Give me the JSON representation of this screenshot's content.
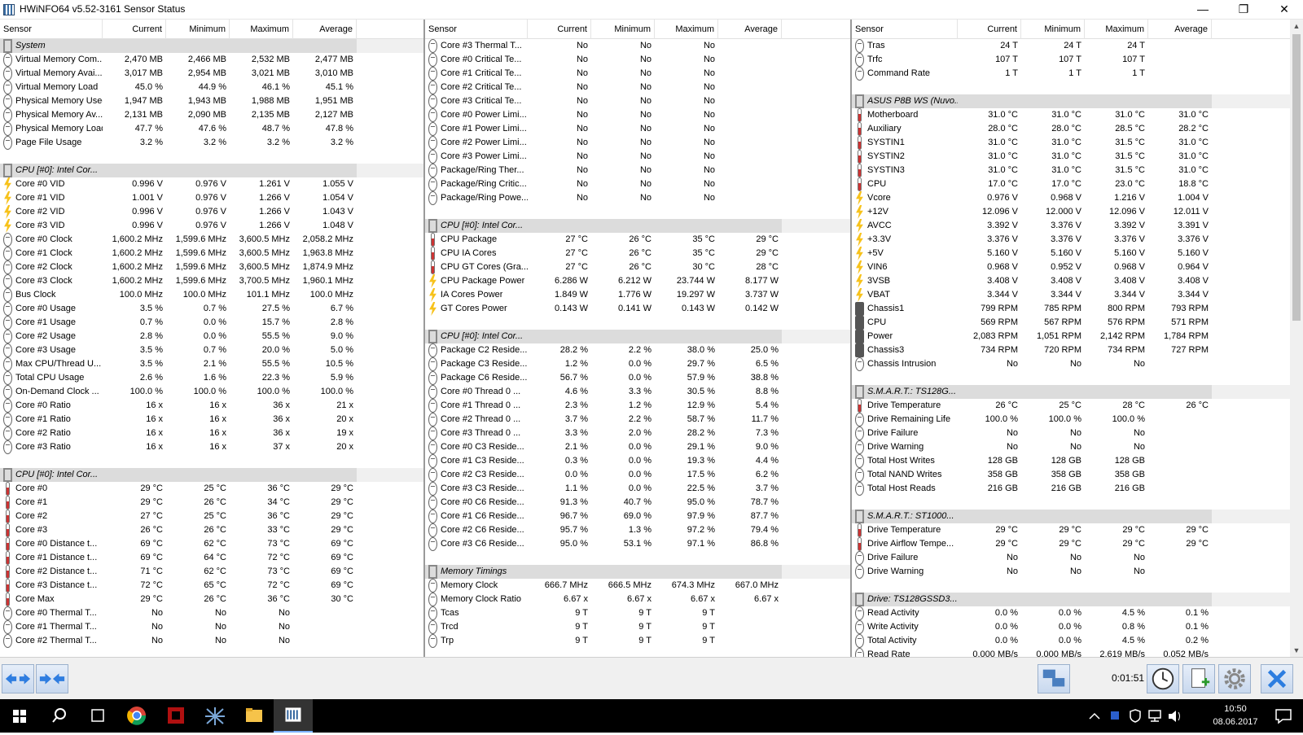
{
  "window": {
    "title": "HWiNFO64 v5.52-3161 Sensor Status",
    "minimize": "—",
    "maximize": "❐",
    "close": "✕"
  },
  "columns": [
    "Sensor",
    "Current",
    "Minimum",
    "Maximum",
    "Average"
  ],
  "panels": [
    {
      "rows": [
        {
          "g": "System"
        },
        [
          "c",
          "Virtual Memory Com...",
          "2,470 MB",
          "2,466 MB",
          "2,532 MB",
          "2,477 MB"
        ],
        [
          "c",
          "Virtual Memory Avai...",
          "3,017 MB",
          "2,954 MB",
          "3,021 MB",
          "3,010 MB"
        ],
        [
          "c",
          "Virtual Memory Load",
          "45.0 %",
          "44.9 %",
          "46.1 %",
          "45.1 %"
        ],
        [
          "c",
          "Physical Memory Used",
          "1,947 MB",
          "1,943 MB",
          "1,988 MB",
          "1,951 MB"
        ],
        [
          "c",
          "Physical Memory Av...",
          "2,131 MB",
          "2,090 MB",
          "2,135 MB",
          "2,127 MB"
        ],
        [
          "c",
          "Physical Memory Load",
          "47.7 %",
          "47.6 %",
          "48.7 %",
          "47.8 %"
        ],
        [
          "c",
          "Page File Usage",
          "3.2 %",
          "3.2 %",
          "3.2 %",
          "3.2 %"
        ],
        {
          "e": 1
        },
        {
          "g": "CPU [#0]: Intel Cor..."
        },
        [
          "v",
          "Core #0 VID",
          "0.996 V",
          "0.976 V",
          "1.261 V",
          "1.055 V"
        ],
        [
          "v",
          "Core #1 VID",
          "1.001 V",
          "0.976 V",
          "1.266 V",
          "1.054 V"
        ],
        [
          "v",
          "Core #2 VID",
          "0.996 V",
          "0.976 V",
          "1.266 V",
          "1.043 V"
        ],
        [
          "v",
          "Core #3 VID",
          "0.996 V",
          "0.976 V",
          "1.266 V",
          "1.048 V"
        ],
        [
          "c",
          "Core #0 Clock",
          "1,600.2 MHz",
          "1,599.6 MHz",
          "3,600.5 MHz",
          "2,058.2 MHz"
        ],
        [
          "c",
          "Core #1 Clock",
          "1,600.2 MHz",
          "1,599.6 MHz",
          "3,600.5 MHz",
          "1,963.8 MHz"
        ],
        [
          "c",
          "Core #2 Clock",
          "1,600.2 MHz",
          "1,599.6 MHz",
          "3,600.5 MHz",
          "1,874.9 MHz"
        ],
        [
          "c",
          "Core #3 Clock",
          "1,600.2 MHz",
          "1,599.6 MHz",
          "3,700.5 MHz",
          "1,960.1 MHz"
        ],
        [
          "c",
          "Bus Clock",
          "100.0 MHz",
          "100.0 MHz",
          "101.1 MHz",
          "100.0 MHz"
        ],
        [
          "c",
          "Core #0 Usage",
          "3.5 %",
          "0.7 %",
          "27.5 %",
          "6.7 %"
        ],
        [
          "c",
          "Core #1 Usage",
          "0.7 %",
          "0.0 %",
          "15.7 %",
          "2.8 %"
        ],
        [
          "c",
          "Core #2 Usage",
          "2.8 %",
          "0.0 %",
          "55.5 %",
          "9.0 %"
        ],
        [
          "c",
          "Core #3 Usage",
          "3.5 %",
          "0.7 %",
          "20.0 %",
          "5.0 %"
        ],
        [
          "c",
          "Max CPU/Thread U...",
          "3.5 %",
          "2.1 %",
          "55.5 %",
          "10.5 %"
        ],
        [
          "c",
          "Total CPU Usage",
          "2.6 %",
          "1.6 %",
          "22.3 %",
          "5.9 %"
        ],
        [
          "c",
          "On-Demand Clock ...",
          "100.0 %",
          "100.0 %",
          "100.0 %",
          "100.0 %"
        ],
        [
          "c",
          "Core #0 Ratio",
          "16 x",
          "16 x",
          "36 x",
          "21 x"
        ],
        [
          "c",
          "Core #1 Ratio",
          "16 x",
          "16 x",
          "36 x",
          "20 x"
        ],
        [
          "c",
          "Core #2 Ratio",
          "16 x",
          "16 x",
          "36 x",
          "19 x"
        ],
        [
          "c",
          "Core #3 Ratio",
          "16 x",
          "16 x",
          "37 x",
          "20 x"
        ],
        {
          "e": 1
        },
        {
          "g": "CPU [#0]: Intel Cor..."
        },
        [
          "t",
          "Core #0",
          "29 °C",
          "25 °C",
          "36 °C",
          "29 °C"
        ],
        [
          "t",
          "Core #1",
          "29 °C",
          "26 °C",
          "34 °C",
          "29 °C"
        ],
        [
          "t",
          "Core #2",
          "27 °C",
          "25 °C",
          "36 °C",
          "29 °C"
        ],
        [
          "t",
          "Core #3",
          "26 °C",
          "26 °C",
          "33 °C",
          "29 °C"
        ],
        [
          "t",
          "Core #0 Distance t...",
          "69 °C",
          "62 °C",
          "73 °C",
          "69 °C"
        ],
        [
          "t",
          "Core #1 Distance t...",
          "69 °C",
          "64 °C",
          "72 °C",
          "69 °C"
        ],
        [
          "t",
          "Core #2 Distance t...",
          "71 °C",
          "62 °C",
          "73 °C",
          "69 °C"
        ],
        [
          "t",
          "Core #3 Distance t...",
          "72 °C",
          "65 °C",
          "72 °C",
          "69 °C"
        ],
        [
          "t",
          "Core Max",
          "29 °C",
          "26 °C",
          "36 °C",
          "30 °C"
        ],
        [
          "c",
          "Core #0 Thermal T...",
          "No",
          "No",
          "No",
          ""
        ],
        [
          "c",
          "Core #1 Thermal T...",
          "No",
          "No",
          "No",
          ""
        ],
        [
          "c",
          "Core #2 Thermal T...",
          "No",
          "No",
          "No",
          ""
        ]
      ]
    },
    {
      "rows": [
        [
          "c",
          "Core #3 Thermal T...",
          "No",
          "No",
          "No",
          ""
        ],
        [
          "c",
          "Core #0 Critical Te...",
          "No",
          "No",
          "No",
          ""
        ],
        [
          "c",
          "Core #1 Critical Te...",
          "No",
          "No",
          "No",
          ""
        ],
        [
          "c",
          "Core #2 Critical Te...",
          "No",
          "No",
          "No",
          ""
        ],
        [
          "c",
          "Core #3 Critical Te...",
          "No",
          "No",
          "No",
          ""
        ],
        [
          "c",
          "Core #0 Power Limi...",
          "No",
          "No",
          "No",
          ""
        ],
        [
          "c",
          "Core #1 Power Limi...",
          "No",
          "No",
          "No",
          ""
        ],
        [
          "c",
          "Core #2 Power Limi...",
          "No",
          "No",
          "No",
          ""
        ],
        [
          "c",
          "Core #3 Power Limi...",
          "No",
          "No",
          "No",
          ""
        ],
        [
          "c",
          "Package/Ring Ther...",
          "No",
          "No",
          "No",
          ""
        ],
        [
          "c",
          "Package/Ring Critic...",
          "No",
          "No",
          "No",
          ""
        ],
        [
          "c",
          "Package/Ring Powe...",
          "No",
          "No",
          "No",
          ""
        ],
        {
          "e": 1
        },
        {
          "g": "CPU [#0]: Intel Cor..."
        },
        [
          "t",
          "CPU Package",
          "27 °C",
          "26 °C",
          "35 °C",
          "29 °C"
        ],
        [
          "t",
          "CPU IA Cores",
          "27 °C",
          "26 °C",
          "35 °C",
          "29 °C"
        ],
        [
          "t",
          "CPU GT Cores (Gra...",
          "27 °C",
          "26 °C",
          "30 °C",
          "28 °C"
        ],
        [
          "v",
          "CPU Package Power",
          "6.286 W",
          "6.212 W",
          "23.744 W",
          "8.177 W"
        ],
        [
          "v",
          "IA Cores Power",
          "1.849 W",
          "1.776 W",
          "19.297 W",
          "3.737 W"
        ],
        [
          "v",
          "GT Cores Power",
          "0.143 W",
          "0.141 W",
          "0.143 W",
          "0.142 W"
        ],
        {
          "e": 1
        },
        {
          "g": "CPU [#0]: Intel Cor..."
        },
        [
          "c",
          "Package C2 Reside...",
          "28.2 %",
          "2.2 %",
          "38.0 %",
          "25.0 %"
        ],
        [
          "c",
          "Package C3 Reside...",
          "1.2 %",
          "0.0 %",
          "29.7 %",
          "6.5 %"
        ],
        [
          "c",
          "Package C6 Reside...",
          "56.7 %",
          "0.0 %",
          "57.9 %",
          "38.8 %"
        ],
        [
          "c",
          "Core #0 Thread 0 ...",
          "4.6 %",
          "3.3 %",
          "30.5 %",
          "8.8 %"
        ],
        [
          "c",
          "Core #1 Thread 0 ...",
          "2.3 %",
          "1.2 %",
          "12.9 %",
          "5.4 %"
        ],
        [
          "c",
          "Core #2 Thread 0 ...",
          "3.7 %",
          "2.2 %",
          "58.7 %",
          "11.7 %"
        ],
        [
          "c",
          "Core #3 Thread 0 ...",
          "3.3 %",
          "2.0 %",
          "28.2 %",
          "7.3 %"
        ],
        [
          "c",
          "Core #0 C3 Reside...",
          "2.1 %",
          "0.0 %",
          "29.1 %",
          "9.0 %"
        ],
        [
          "c",
          "Core #1 C3 Reside...",
          "0.3 %",
          "0.0 %",
          "19.3 %",
          "4.4 %"
        ],
        [
          "c",
          "Core #2 C3 Reside...",
          "0.0 %",
          "0.0 %",
          "17.5 %",
          "6.2 %"
        ],
        [
          "c",
          "Core #3 C3 Reside...",
          "1.1 %",
          "0.0 %",
          "22.5 %",
          "3.7 %"
        ],
        [
          "c",
          "Core #0 C6 Reside...",
          "91.3 %",
          "40.7 %",
          "95.0 %",
          "78.7 %"
        ],
        [
          "c",
          "Core #1 C6 Reside...",
          "96.7 %",
          "69.0 %",
          "97.9 %",
          "87.7 %"
        ],
        [
          "c",
          "Core #2 C6 Reside...",
          "95.7 %",
          "1.3 %",
          "97.2 %",
          "79.4 %"
        ],
        [
          "c",
          "Core #3 C6 Reside...",
          "95.0 %",
          "53.1 %",
          "97.1 %",
          "86.8 %"
        ],
        {
          "e": 1
        },
        {
          "g": "Memory Timings"
        },
        [
          "c",
          "Memory Clock",
          "666.7 MHz",
          "666.5 MHz",
          "674.3 MHz",
          "667.0 MHz"
        ],
        [
          "c",
          "Memory Clock Ratio",
          "6.67 x",
          "6.67 x",
          "6.67 x",
          "6.67 x"
        ],
        [
          "c",
          "Tcas",
          "9 T",
          "9 T",
          "9 T",
          ""
        ],
        [
          "c",
          "Trcd",
          "9 T",
          "9 T",
          "9 T",
          ""
        ],
        [
          "c",
          "Trp",
          "9 T",
          "9 T",
          "9 T",
          ""
        ]
      ]
    },
    {
      "rows": [
        [
          "c",
          "Tras",
          "24 T",
          "24 T",
          "24 T",
          ""
        ],
        [
          "c",
          "Trfc",
          "107 T",
          "107 T",
          "107 T",
          ""
        ],
        [
          "c",
          "Command Rate",
          "1 T",
          "1 T",
          "1 T",
          ""
        ],
        {
          "e": 1
        },
        {
          "g": "ASUS P8B WS (Nuvo..."
        },
        [
          "t",
          "Motherboard",
          "31.0 °C",
          "31.0 °C",
          "31.0 °C",
          "31.0 °C"
        ],
        [
          "t",
          "Auxiliary",
          "28.0 °C",
          "28.0 °C",
          "28.5 °C",
          "28.2 °C"
        ],
        [
          "t",
          "SYSTIN1",
          "31.0 °C",
          "31.0 °C",
          "31.5 °C",
          "31.0 °C"
        ],
        [
          "t",
          "SYSTIN2",
          "31.0 °C",
          "31.0 °C",
          "31.5 °C",
          "31.0 °C"
        ],
        [
          "t",
          "SYSTIN3",
          "31.0 °C",
          "31.0 °C",
          "31.5 °C",
          "31.0 °C"
        ],
        [
          "t",
          "CPU",
          "17.0 °C",
          "17.0 °C",
          "23.0 °C",
          "18.8 °C"
        ],
        [
          "v",
          "Vcore",
          "0.976 V",
          "0.968 V",
          "1.216 V",
          "1.004 V"
        ],
        [
          "v",
          "+12V",
          "12.096 V",
          "12.000 V",
          "12.096 V",
          "12.011 V"
        ],
        [
          "v",
          "AVCC",
          "3.392 V",
          "3.376 V",
          "3.392 V",
          "3.391 V"
        ],
        [
          "v",
          "+3.3V",
          "3.376 V",
          "3.376 V",
          "3.376 V",
          "3.376 V"
        ],
        [
          "v",
          "+5V",
          "5.160 V",
          "5.160 V",
          "5.160 V",
          "5.160 V"
        ],
        [
          "v",
          "VIN6",
          "0.968 V",
          "0.952 V",
          "0.968 V",
          "0.964 V"
        ],
        [
          "v",
          "3VSB",
          "3.408 V",
          "3.408 V",
          "3.408 V",
          "3.408 V"
        ],
        [
          "v",
          "VBAT",
          "3.344 V",
          "3.344 V",
          "3.344 V",
          "3.344 V"
        ],
        [
          "f",
          "Chassis1",
          "799 RPM",
          "785 RPM",
          "800 RPM",
          "793 RPM"
        ],
        [
          "f",
          "CPU",
          "569 RPM",
          "567 RPM",
          "576 RPM",
          "571 RPM"
        ],
        [
          "f",
          "Power",
          "2,083 RPM",
          "1,051 RPM",
          "2,142 RPM",
          "1,784 RPM"
        ],
        [
          "f",
          "Chassis3",
          "734 RPM",
          "720 RPM",
          "734 RPM",
          "727 RPM"
        ],
        [
          "c",
          "Chassis Intrusion",
          "No",
          "No",
          "No",
          ""
        ],
        {
          "e": 1
        },
        {
          "g": "S.M.A.R.T.: TS128G..."
        },
        [
          "t",
          "Drive Temperature",
          "26 °C",
          "25 °C",
          "28 °C",
          "26 °C"
        ],
        [
          "c",
          "Drive Remaining Life",
          "100.0 %",
          "100.0 %",
          "100.0 %",
          ""
        ],
        [
          "c",
          "Drive Failure",
          "No",
          "No",
          "No",
          ""
        ],
        [
          "c",
          "Drive Warning",
          "No",
          "No",
          "No",
          ""
        ],
        [
          "c",
          "Total Host Writes",
          "128 GB",
          "128 GB",
          "128 GB",
          ""
        ],
        [
          "c",
          "Total NAND Writes",
          "358 GB",
          "358 GB",
          "358 GB",
          ""
        ],
        [
          "c",
          "Total Host Reads",
          "216 GB",
          "216 GB",
          "216 GB",
          ""
        ],
        {
          "e": 1
        },
        {
          "g": "S.M.A.R.T.: ST1000..."
        },
        [
          "t",
          "Drive Temperature",
          "29 °C",
          "29 °C",
          "29 °C",
          "29 °C"
        ],
        [
          "t",
          "Drive Airflow Tempe...",
          "29 °C",
          "29 °C",
          "29 °C",
          "29 °C"
        ],
        [
          "c",
          "Drive Failure",
          "No",
          "No",
          "No",
          ""
        ],
        [
          "c",
          "Drive Warning",
          "No",
          "No",
          "No",
          ""
        ],
        {
          "e": 1
        },
        {
          "g": "Drive: TS128GSSD3..."
        },
        [
          "c",
          "Read Activity",
          "0.0 %",
          "0.0 %",
          "4.5 %",
          "0.1 %"
        ],
        [
          "c",
          "Write Activity",
          "0.0 %",
          "0.0 %",
          "0.8 %",
          "0.1 %"
        ],
        [
          "c",
          "Total Activity",
          "0.0 %",
          "0.0 %",
          "4.5 %",
          "0.2 %"
        ],
        [
          "c",
          "Read Rate",
          "0.000 MB/s",
          "0.000 MB/s",
          "2.619 MB/s",
          "0.052 MB/s"
        ]
      ]
    }
  ],
  "bottombar": {
    "uptime": "0:01:51"
  },
  "taskbar": {
    "time": "10:50",
    "date": "08.06.2017"
  }
}
